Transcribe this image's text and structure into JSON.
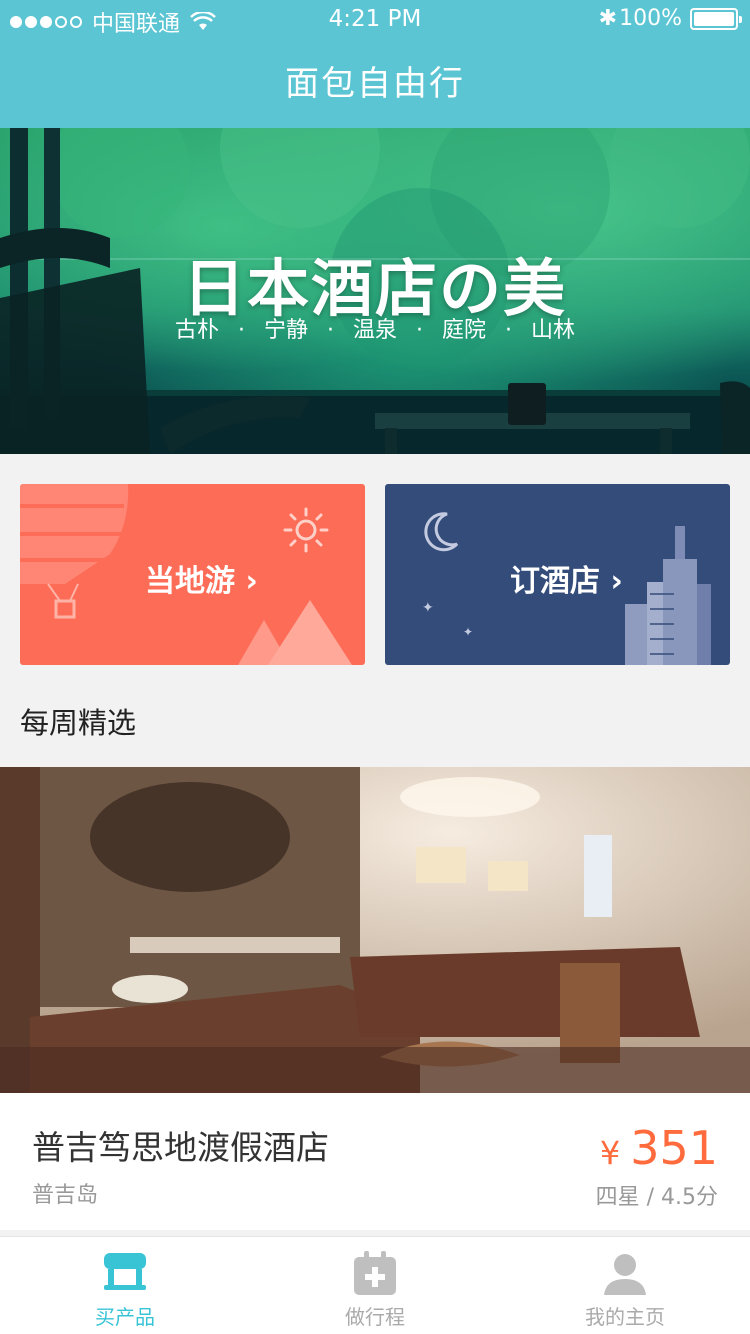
{
  "status_bar": {
    "carrier": "中国联通",
    "time": "4:21 PM",
    "battery": "100%",
    "bluetooth_icon": "bluetooth-icon",
    "wifi_icon": "wifi-icon"
  },
  "nav": {
    "title": "面包自由行"
  },
  "banner": {
    "title": "日本酒店の美",
    "tags": [
      "古朴",
      "·",
      "宁静",
      "·",
      "温泉",
      "·",
      "庭院",
      "·",
      "山林"
    ]
  },
  "cards": {
    "local": {
      "label": "当地游 ›",
      "color": "#fd6c57"
    },
    "hotel": {
      "label": "订酒店 ›",
      "color": "#344c7a"
    }
  },
  "section": {
    "title": "每周精选"
  },
  "featured": {
    "name": "普吉笃思地渡假酒店",
    "location": "普吉岛",
    "currency": "¥",
    "price": "351",
    "rating": "四星 / 4.5分",
    "price_color": "#ff6b3d"
  },
  "tabs": [
    {
      "label": "买产品",
      "icon": "shop-icon",
      "active": true
    },
    {
      "label": "做行程",
      "icon": "calendar-add-icon",
      "active": false
    },
    {
      "label": "我的主页",
      "icon": "user-icon",
      "active": false
    }
  ],
  "theme": {
    "primary": "#5bc5d3",
    "tab_active": "#39c4d6"
  }
}
